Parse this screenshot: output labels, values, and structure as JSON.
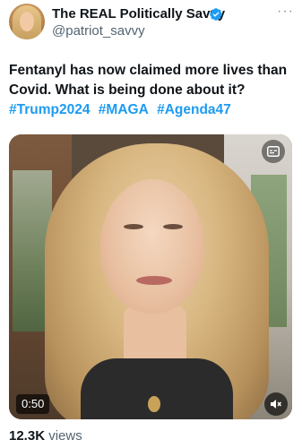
{
  "author": {
    "display_name": "The REAL Politically Savvy",
    "handle": "@patriot_savvy",
    "verified_icon": "verified-badge-icon",
    "more_icon": "more-options-icon"
  },
  "tweet": {
    "text_line1": "Fentanyl has now claimed more lives than",
    "text_line2": "Covid. What is being done about it?",
    "hashtags": [
      "#Trump2024",
      "#MAGA",
      "#Agenda47"
    ]
  },
  "media": {
    "duration": "0:50",
    "gif_icon": "captions-icon",
    "mute_icon": "volume-muted-icon"
  },
  "stats": {
    "views_count": "12.3K",
    "views_label": " views"
  },
  "colors": {
    "accent": "#1d9bf0",
    "text": "#0f1419",
    "muted": "#536471"
  }
}
